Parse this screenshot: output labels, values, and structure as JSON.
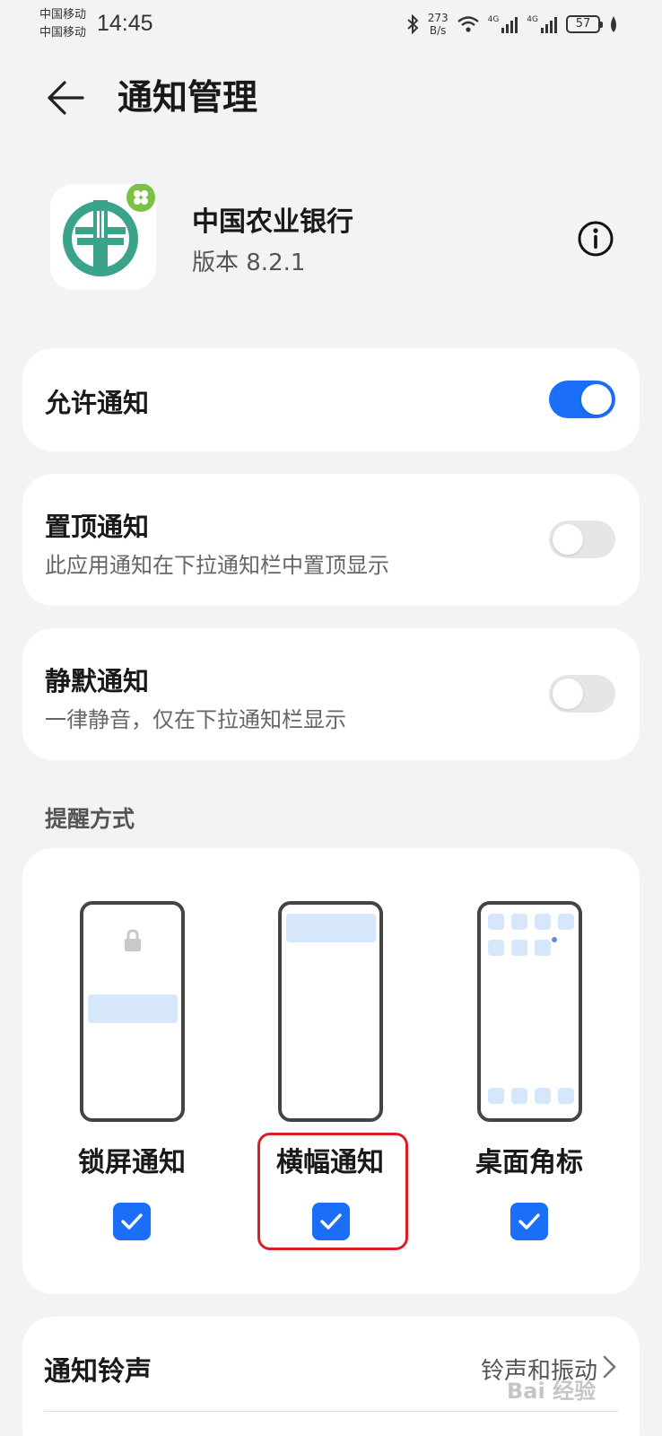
{
  "status_bar": {
    "carrier_1": "中国移动",
    "carrier_2": "中国移动",
    "time": "14:45",
    "net_speed_value": "273",
    "net_speed_unit": "B/s",
    "net_type_1": "4G",
    "net_type_2": "4G",
    "battery": "57",
    "icons": [
      "bluetooth-icon",
      "wifi-icon",
      "signal-icon",
      "signal-icon",
      "battery-icon",
      "leaf-icon"
    ]
  },
  "header": {
    "title": "通知管理",
    "back_icon": "arrow-left-icon"
  },
  "app": {
    "name": "中国农业银行",
    "version": "版本 8.2.1",
    "icon": "abc-bank-logo",
    "info_icon": "info-circle-icon"
  },
  "settings": {
    "allow_notifications": {
      "title": "允许通知",
      "enabled": true
    },
    "pin_notifications": {
      "title": "置顶通知",
      "subtitle": "此应用通知在下拉通知栏中置顶显示",
      "enabled": false
    },
    "silent_notifications": {
      "title": "静默通知",
      "subtitle": "一律静音，仅在下拉通知栏显示",
      "enabled": false
    }
  },
  "reminder": {
    "section_label": "提醒方式",
    "modes": [
      {
        "label": "锁屏通知",
        "checked": true
      },
      {
        "label": "横幅通知",
        "checked": true
      },
      {
        "label": "桌面角标",
        "checked": true
      }
    ]
  },
  "ringtone": {
    "title": "通知铃声",
    "value": "铃声和振动"
  },
  "colors": {
    "accent": "#1a6ef7",
    "highlight": "#d81f26",
    "background": "#f1f3f5",
    "logo_green": "#3aa38a"
  },
  "watermark": "Bai 经验"
}
